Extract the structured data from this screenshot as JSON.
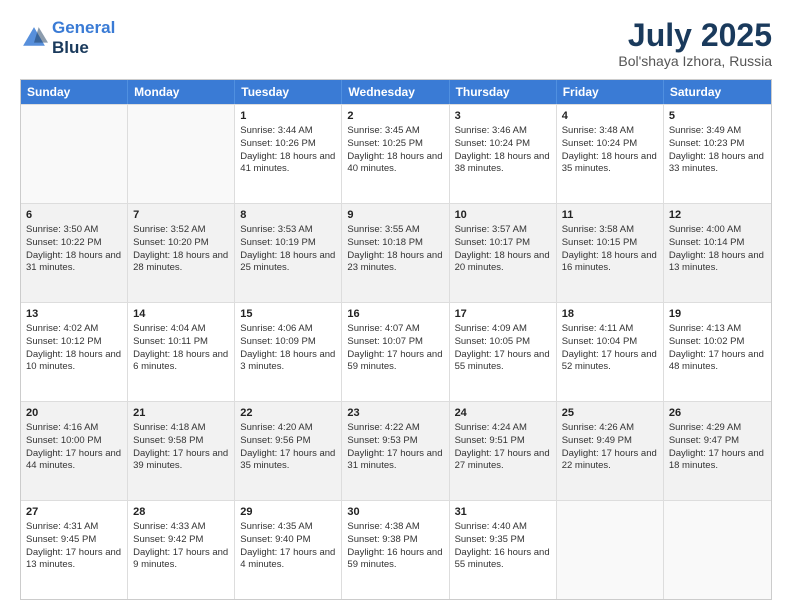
{
  "header": {
    "logo_line1": "General",
    "logo_line2": "Blue",
    "title": "July 2025",
    "subtitle": "Bol'shaya Izhora, Russia"
  },
  "days_of_week": [
    "Sunday",
    "Monday",
    "Tuesday",
    "Wednesday",
    "Thursday",
    "Friday",
    "Saturday"
  ],
  "weeks": [
    [
      {
        "day": "",
        "info": "",
        "shaded": false,
        "empty": true
      },
      {
        "day": "",
        "info": "",
        "shaded": false,
        "empty": true
      },
      {
        "day": "1",
        "info": "Sunrise: 3:44 AM\nSunset: 10:26 PM\nDaylight: 18 hours and 41 minutes.",
        "shaded": false,
        "empty": false
      },
      {
        "day": "2",
        "info": "Sunrise: 3:45 AM\nSunset: 10:25 PM\nDaylight: 18 hours and 40 minutes.",
        "shaded": false,
        "empty": false
      },
      {
        "day": "3",
        "info": "Sunrise: 3:46 AM\nSunset: 10:24 PM\nDaylight: 18 hours and 38 minutes.",
        "shaded": false,
        "empty": false
      },
      {
        "day": "4",
        "info": "Sunrise: 3:48 AM\nSunset: 10:24 PM\nDaylight: 18 hours and 35 minutes.",
        "shaded": false,
        "empty": false
      },
      {
        "day": "5",
        "info": "Sunrise: 3:49 AM\nSunset: 10:23 PM\nDaylight: 18 hours and 33 minutes.",
        "shaded": false,
        "empty": false
      }
    ],
    [
      {
        "day": "6",
        "info": "Sunrise: 3:50 AM\nSunset: 10:22 PM\nDaylight: 18 hours and 31 minutes.",
        "shaded": true,
        "empty": false
      },
      {
        "day": "7",
        "info": "Sunrise: 3:52 AM\nSunset: 10:20 PM\nDaylight: 18 hours and 28 minutes.",
        "shaded": true,
        "empty": false
      },
      {
        "day": "8",
        "info": "Sunrise: 3:53 AM\nSunset: 10:19 PM\nDaylight: 18 hours and 25 minutes.",
        "shaded": true,
        "empty": false
      },
      {
        "day": "9",
        "info": "Sunrise: 3:55 AM\nSunset: 10:18 PM\nDaylight: 18 hours and 23 minutes.",
        "shaded": true,
        "empty": false
      },
      {
        "day": "10",
        "info": "Sunrise: 3:57 AM\nSunset: 10:17 PM\nDaylight: 18 hours and 20 minutes.",
        "shaded": true,
        "empty": false
      },
      {
        "day": "11",
        "info": "Sunrise: 3:58 AM\nSunset: 10:15 PM\nDaylight: 18 hours and 16 minutes.",
        "shaded": true,
        "empty": false
      },
      {
        "day": "12",
        "info": "Sunrise: 4:00 AM\nSunset: 10:14 PM\nDaylight: 18 hours and 13 minutes.",
        "shaded": true,
        "empty": false
      }
    ],
    [
      {
        "day": "13",
        "info": "Sunrise: 4:02 AM\nSunset: 10:12 PM\nDaylight: 18 hours and 10 minutes.",
        "shaded": false,
        "empty": false
      },
      {
        "day": "14",
        "info": "Sunrise: 4:04 AM\nSunset: 10:11 PM\nDaylight: 18 hours and 6 minutes.",
        "shaded": false,
        "empty": false
      },
      {
        "day": "15",
        "info": "Sunrise: 4:06 AM\nSunset: 10:09 PM\nDaylight: 18 hours and 3 minutes.",
        "shaded": false,
        "empty": false
      },
      {
        "day": "16",
        "info": "Sunrise: 4:07 AM\nSunset: 10:07 PM\nDaylight: 17 hours and 59 minutes.",
        "shaded": false,
        "empty": false
      },
      {
        "day": "17",
        "info": "Sunrise: 4:09 AM\nSunset: 10:05 PM\nDaylight: 17 hours and 55 minutes.",
        "shaded": false,
        "empty": false
      },
      {
        "day": "18",
        "info": "Sunrise: 4:11 AM\nSunset: 10:04 PM\nDaylight: 17 hours and 52 minutes.",
        "shaded": false,
        "empty": false
      },
      {
        "day": "19",
        "info": "Sunrise: 4:13 AM\nSunset: 10:02 PM\nDaylight: 17 hours and 48 minutes.",
        "shaded": false,
        "empty": false
      }
    ],
    [
      {
        "day": "20",
        "info": "Sunrise: 4:16 AM\nSunset: 10:00 PM\nDaylight: 17 hours and 44 minutes.",
        "shaded": true,
        "empty": false
      },
      {
        "day": "21",
        "info": "Sunrise: 4:18 AM\nSunset: 9:58 PM\nDaylight: 17 hours and 39 minutes.",
        "shaded": true,
        "empty": false
      },
      {
        "day": "22",
        "info": "Sunrise: 4:20 AM\nSunset: 9:56 PM\nDaylight: 17 hours and 35 minutes.",
        "shaded": true,
        "empty": false
      },
      {
        "day": "23",
        "info": "Sunrise: 4:22 AM\nSunset: 9:53 PM\nDaylight: 17 hours and 31 minutes.",
        "shaded": true,
        "empty": false
      },
      {
        "day": "24",
        "info": "Sunrise: 4:24 AM\nSunset: 9:51 PM\nDaylight: 17 hours and 27 minutes.",
        "shaded": true,
        "empty": false
      },
      {
        "day": "25",
        "info": "Sunrise: 4:26 AM\nSunset: 9:49 PM\nDaylight: 17 hours and 22 minutes.",
        "shaded": true,
        "empty": false
      },
      {
        "day": "26",
        "info": "Sunrise: 4:29 AM\nSunset: 9:47 PM\nDaylight: 17 hours and 18 minutes.",
        "shaded": true,
        "empty": false
      }
    ],
    [
      {
        "day": "27",
        "info": "Sunrise: 4:31 AM\nSunset: 9:45 PM\nDaylight: 17 hours and 13 minutes.",
        "shaded": false,
        "empty": false
      },
      {
        "day": "28",
        "info": "Sunrise: 4:33 AM\nSunset: 9:42 PM\nDaylight: 17 hours and 9 minutes.",
        "shaded": false,
        "empty": false
      },
      {
        "day": "29",
        "info": "Sunrise: 4:35 AM\nSunset: 9:40 PM\nDaylight: 17 hours and 4 minutes.",
        "shaded": false,
        "empty": false
      },
      {
        "day": "30",
        "info": "Sunrise: 4:38 AM\nSunset: 9:38 PM\nDaylight: 16 hours and 59 minutes.",
        "shaded": false,
        "empty": false
      },
      {
        "day": "31",
        "info": "Sunrise: 4:40 AM\nSunset: 9:35 PM\nDaylight: 16 hours and 55 minutes.",
        "shaded": false,
        "empty": false
      },
      {
        "day": "",
        "info": "",
        "shaded": false,
        "empty": true
      },
      {
        "day": "",
        "info": "",
        "shaded": false,
        "empty": true
      }
    ]
  ]
}
